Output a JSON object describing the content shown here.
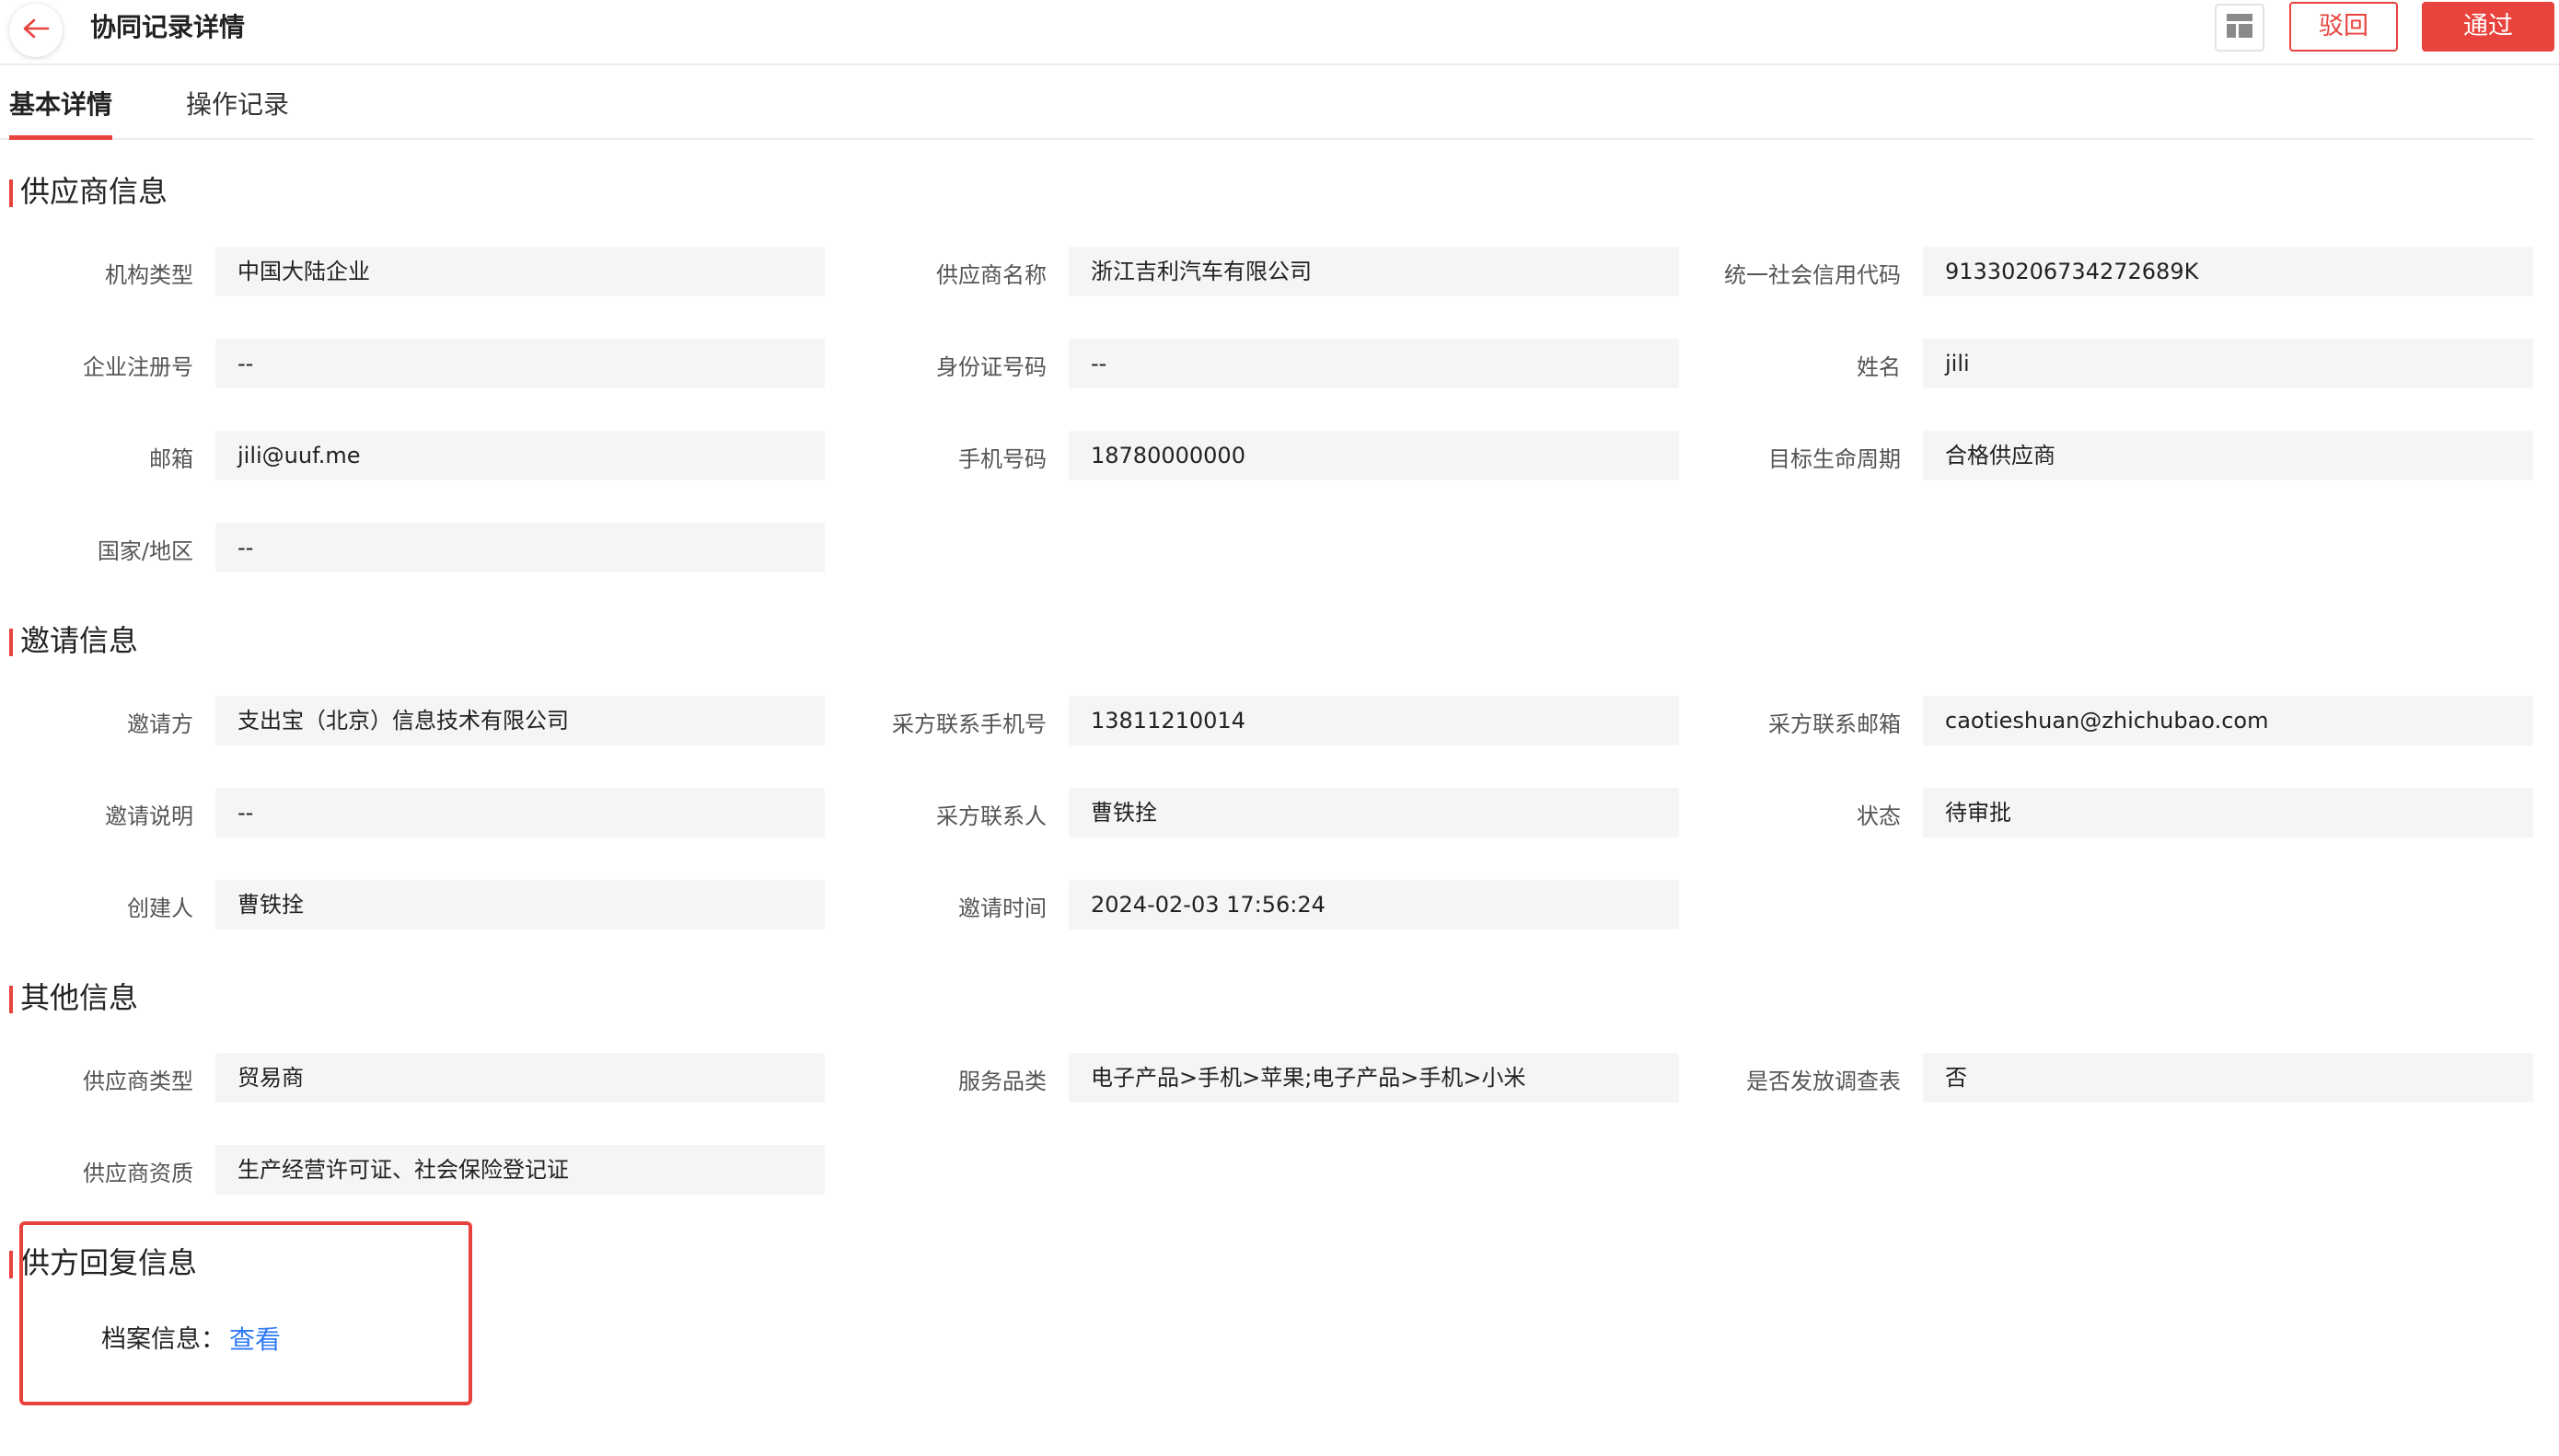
{
  "header": {
    "title": "协同记录详情",
    "reject_label": "驳回",
    "pass_label": "通过"
  },
  "tabs": [
    {
      "label": "基本详情",
      "active": true
    },
    {
      "label": "操作记录",
      "active": false
    }
  ],
  "supplier_info": {
    "title": "供应商信息",
    "fields": [
      {
        "label": "机构类型",
        "value": "中国大陆企业"
      },
      {
        "label": "供应商名称",
        "value": "浙江吉利汽车有限公司"
      },
      {
        "label": "统一社会信用代码",
        "value": "91330206734272689K"
      },
      {
        "label": "企业注册号",
        "value": "--"
      },
      {
        "label": "身份证号码",
        "value": "--"
      },
      {
        "label": "姓名",
        "value": "jili"
      },
      {
        "label": "邮箱",
        "value": "jili@uuf.me"
      },
      {
        "label": "手机号码",
        "value": "18780000000"
      },
      {
        "label": "目标生命周期",
        "value": "合格供应商"
      },
      {
        "label": "国家/地区",
        "value": "--"
      }
    ]
  },
  "invite_info": {
    "title": "邀请信息",
    "fields": [
      {
        "label": "邀请方",
        "value": "支出宝（北京）信息技术有限公司"
      },
      {
        "label": "采方联系手机号",
        "value": "13811210014"
      },
      {
        "label": "采方联系邮箱",
        "value": "caotieshuan@zhichubao.com"
      },
      {
        "label": "邀请说明",
        "value": "--"
      },
      {
        "label": "采方联系人",
        "value": "曹铁拴"
      },
      {
        "label": "状态",
        "value": "待审批"
      },
      {
        "label": "创建人",
        "value": "曹铁拴"
      },
      {
        "label": "邀请时间",
        "value": "2024-02-03 17:56:24"
      }
    ]
  },
  "other_info": {
    "title": "其他信息",
    "fields": [
      {
        "label": "供应商类型",
        "value": "贸易商"
      },
      {
        "label": "服务品类",
        "value": "电子产品>手机>苹果;电子产品>手机>小米"
      },
      {
        "label": "是否发放调查表",
        "value": "否"
      },
      {
        "label": "供应商资质",
        "value": "生产经营许可证、社会保险登记证"
      }
    ]
  },
  "reply_info": {
    "title": "供方回复信息",
    "archive_label": "档案信息：",
    "archive_link": "查看"
  },
  "colors": {
    "accent": "#e8433d",
    "link": "#2f7bf5",
    "field_bg": "#f5f5f5"
  }
}
